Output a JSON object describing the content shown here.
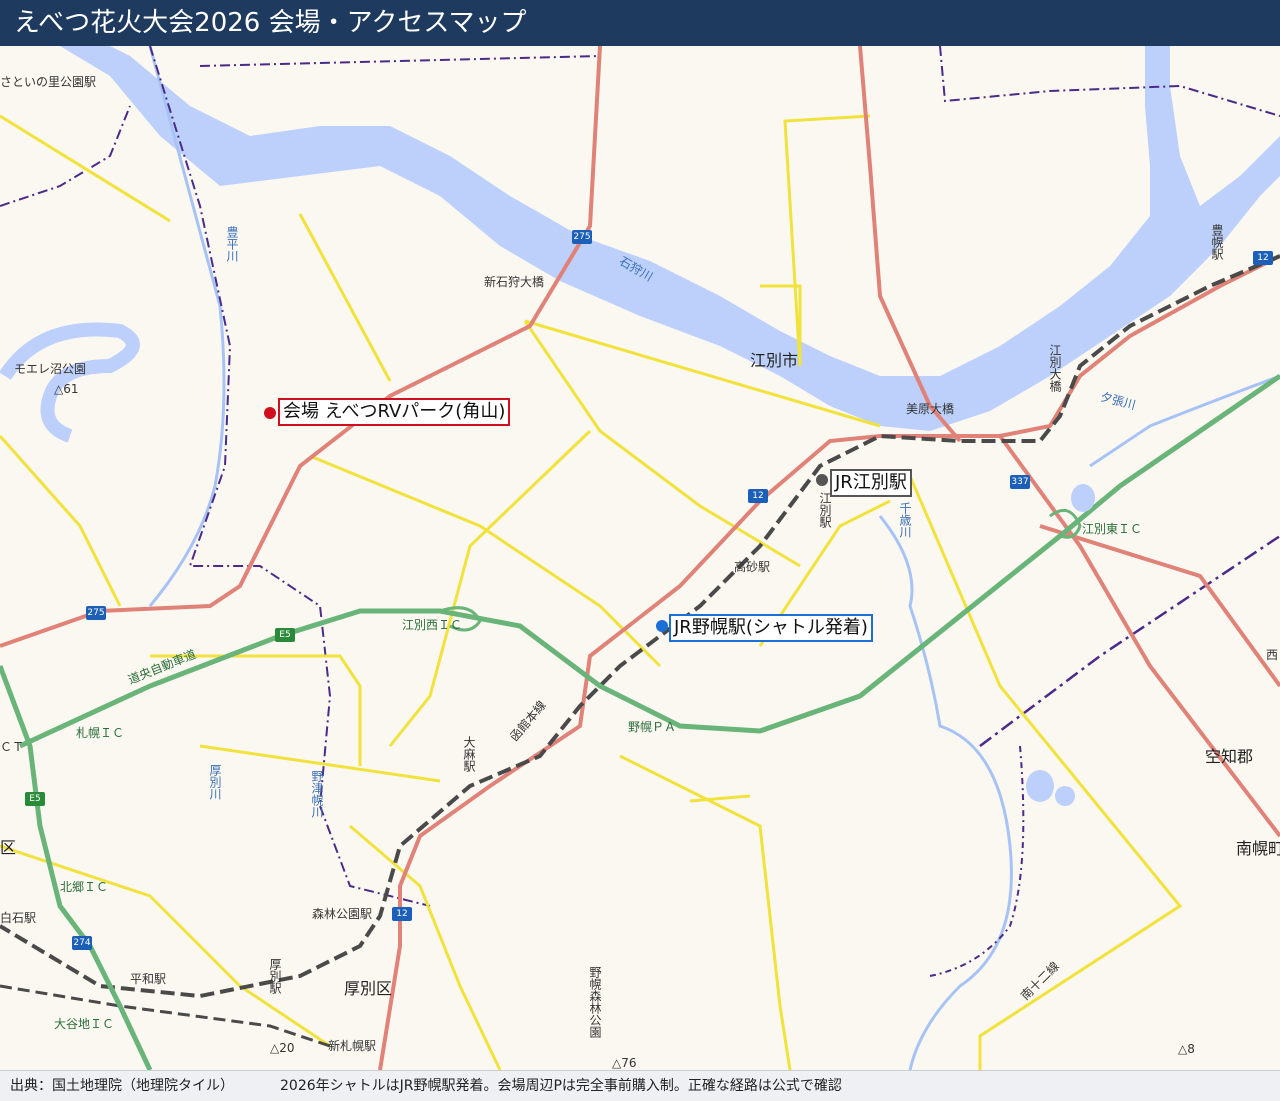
{
  "header": {
    "title": "えべつ花火大会2026 会場・アクセスマップ"
  },
  "callouts": {
    "venue": "会場 えべつRVパーク(角山)",
    "ebetsu_station": "JR江別駅",
    "nopporo_station": "JR野幌駅(シャトル発着)"
  },
  "colors": {
    "venue": "#d0101e",
    "station": "#555555",
    "shuttle": "#1b6fd6",
    "header": "#1f3a5f"
  },
  "labels": {
    "ebetsu_city": "江別市",
    "sorachi": "空知郡",
    "minami_horomui": "南幌町",
    "atsubetsu_ku": "厚別区",
    "moere": "モエレ沼公園",
    "moere_elev": "△61",
    "sato_park": "さといの里公園駅",
    "shin_ishikari_bridge": "新石狩大橋",
    "ishikari_river": "石狩川",
    "yubari_river": "夕張川",
    "toyohira_river": "豊平川",
    "bihara_bridge": "美原大橋",
    "ebetsu_bridge": "江別大橋",
    "toyohoro_eki": "豊幌駅",
    "ebetsu_eki": "江別駅",
    "takasago_eki": "高砂駅",
    "oasa_eki": "大麻駅",
    "shinrinkoen_eki": "森林公園駅",
    "atsubetsu_eki": "厚別駅",
    "heiwa_eki": "平和駅",
    "shinsapporo_eki": "新札幌駅",
    "shiroishi_eki": "白石駅",
    "ebetsu_nishi_ic": "江別西ＩＣ",
    "ebetsu_higashi_ic": "江別東ＩＣ",
    "sapporo_ic": "札幌ＩＣ",
    "kitago_ic": "北郷ＩＣ",
    "oyachi_ic": "大谷地ＩＣ",
    "nopporo_pa": "野幌ＰＡ",
    "doo_expressway": "道央自動車道",
    "hakodate_line": "函館本線",
    "nopporo_forest": "野幌森林公園",
    "nopporo_tsu_river": "野津幌川",
    "atsubetsu_river": "厚別川",
    "chitose_river": "千歳川",
    "minami12": "南十二線",
    "elev_76": "△76",
    "elev_20": "△20",
    "elev_8": "△8",
    "ct": "ＣＴ",
    "ku": "区",
    "nishi": "西"
  },
  "shields": {
    "r275a": "275",
    "r275b": "275",
    "r12a": "12",
    "r12b": "12",
    "r12c": "12",
    "r337": "337",
    "r274": "274",
    "e5a": "E5",
    "e5b": "E5"
  },
  "footer": {
    "source": "出典：国土地理院（地理院タイル）",
    "note": "2026年シャトルはJR野幌駅発着。会場周辺Pは完全事前購入制。正確な経路は公式で確認"
  }
}
